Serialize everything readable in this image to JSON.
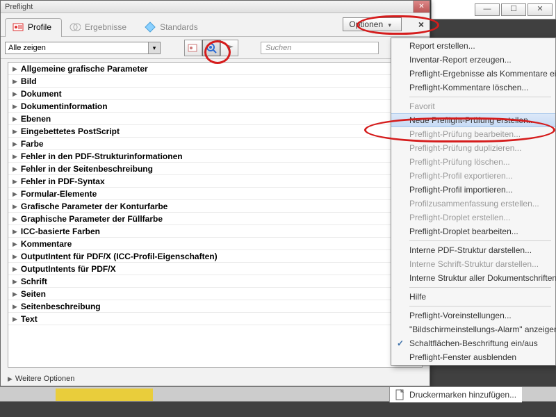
{
  "window": {
    "title": "Preflight"
  },
  "tabs": {
    "profile": "Profile",
    "ergebnisse": "Ergebnisse",
    "standards": "Standards"
  },
  "options_btn": "Optionen",
  "filter": {
    "combo": "Alle zeigen",
    "search_placeholder": "Suchen"
  },
  "tree": [
    "Allgemeine grafische Parameter",
    "Bild",
    "Dokument",
    "Dokumentinformation",
    "Ebenen",
    "Eingebettetes PostScript",
    "Farbe",
    "Fehler in den PDF-Strukturinformationen",
    "Fehler in der Seitenbeschreibung",
    "Fehler in PDF-Syntax",
    "Formular-Elemente",
    "Grafische Parameter der Konturfarbe",
    "Graphische Parameter der Füllfarbe",
    "ICC-basierte Farben",
    "Kommentare",
    "OutputIntent für PDF/X (ICC-Profil-Eigenschaften)",
    "OutputIntents für PDF/X",
    "Schrift",
    "Seiten",
    "Seitenbeschreibung",
    "Text"
  ],
  "footer": "Weitere Optionen",
  "menu": [
    {
      "label": "Report erstellen...",
      "enabled": true
    },
    {
      "label": "Inventar-Report erzeugen...",
      "enabled": true
    },
    {
      "label": "Preflight-Ergebnisse als Kommentare einfügen",
      "enabled": true
    },
    {
      "label": "Preflight-Kommentare löschen...",
      "enabled": true
    },
    {
      "sep": true
    },
    {
      "label": "Favorit",
      "enabled": false
    },
    {
      "label": "Neue Preflight-Prüfung erstellen...",
      "enabled": true,
      "hover": true
    },
    {
      "label": "Preflight-Prüfung bearbeiten...",
      "enabled": false
    },
    {
      "label": "Preflight-Prüfung duplizieren...",
      "enabled": false
    },
    {
      "label": "Preflight-Prüfung löschen...",
      "enabled": false
    },
    {
      "label": "Preflight-Profil exportieren...",
      "enabled": false
    },
    {
      "label": "Preflight-Profil importieren...",
      "enabled": true
    },
    {
      "label": "Profilzusammenfassung erstellen...",
      "enabled": false
    },
    {
      "label": "Preflight-Droplet erstellen...",
      "enabled": false
    },
    {
      "label": "Preflight-Droplet bearbeiten...",
      "enabled": true
    },
    {
      "sep": true
    },
    {
      "label": "Interne PDF-Struktur darstellen...",
      "enabled": true
    },
    {
      "label": "Interne Schrift-Struktur darstellen...",
      "enabled": false
    },
    {
      "label": "Interne Struktur aller Dokumentschriften darstellen",
      "enabled": true
    },
    {
      "sep": true
    },
    {
      "label": "Hilfe",
      "enabled": true
    },
    {
      "sep": true
    },
    {
      "label": "Preflight-Voreinstellungen...",
      "enabled": true
    },
    {
      "label": "\"Bildschirmeinstellungs-Alarm\" anzeigen",
      "enabled": true
    },
    {
      "label": "Schaltflächen-Beschriftung ein/aus",
      "enabled": true,
      "check": true
    },
    {
      "label": "Preflight-Fenster ausblenden",
      "enabled": true
    }
  ],
  "bottom": "Druckermarken hinzufügen..."
}
